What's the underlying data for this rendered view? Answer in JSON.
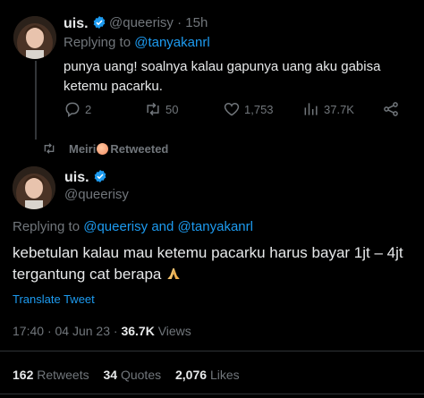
{
  "reply_tweet": {
    "display_name": "uis.",
    "handle": "@queerisy",
    "time": "15h",
    "replying_prefix": "Replying to",
    "replying_to": "@tanyakanrl",
    "text": "punya uang! soalnya kalau gapunya uang aku gabisa ketemu pacarku.",
    "actions": {
      "reply_count": "2",
      "retweet_count": "50",
      "like_count": "1,753",
      "view_count": "37.7K"
    }
  },
  "retweet_banner": {
    "name": "Meiri",
    "label": "Retweeted"
  },
  "main_tweet": {
    "display_name": "uis.",
    "handle": "@queerisy",
    "replying_prefix": "Replying to",
    "replying_to_1": "@queerisy",
    "replying_and": "and",
    "replying_to_2": "@tanyakanrl",
    "text": "kebetulan kalau mau ketemu pacarku harus bayar 1jt – 4jt tergantung cat berapa",
    "translate_label": "Translate Tweet",
    "time": "17:40",
    "date": "04 Jun 23",
    "views_count": "36.7K",
    "views_label": "Views"
  },
  "stats": {
    "retweets_count": "162",
    "retweets_label": "Retweets",
    "quotes_count": "34",
    "quotes_label": "Quotes",
    "likes_count": "2,076",
    "likes_label": "Likes"
  },
  "colors": {
    "background": "#000000",
    "text_primary": "#e7e9ea",
    "text_secondary": "#71767b",
    "link": "#1d9bf0",
    "divider": "#2f3336"
  }
}
